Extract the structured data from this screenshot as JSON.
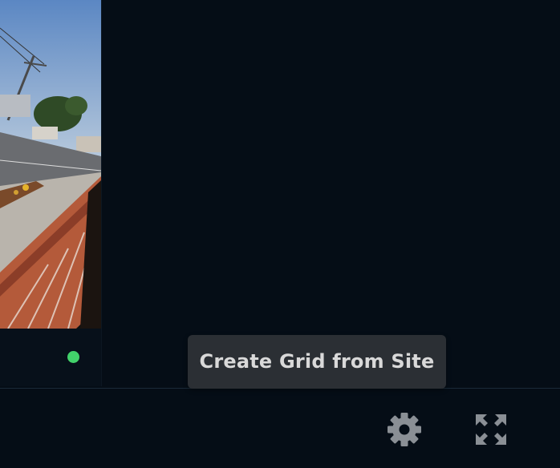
{
  "camera": {
    "status_color": "#42d26b"
  },
  "tooltip": {
    "text": "Create Grid from Site"
  },
  "toolbar": {
    "settings_icon": "gear-icon",
    "fullscreen_icon": "expand-arrows-icon"
  },
  "colors": {
    "background": "#050d16",
    "tooltip_bg": "#2b2f34",
    "icon": "#8a8f95"
  }
}
